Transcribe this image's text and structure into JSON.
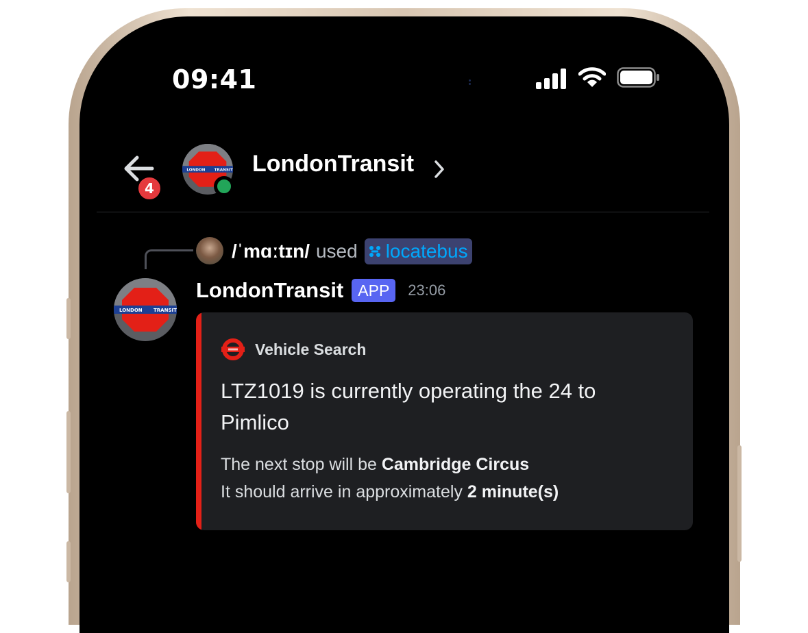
{
  "status_bar": {
    "time": "09:41",
    "icons": [
      "cellular-signal-icon",
      "wifi-icon",
      "battery-icon"
    ]
  },
  "header": {
    "back_icon": "arrow-left-icon",
    "unread_count": "4",
    "title": "LondonTransit",
    "chevron_icon": "chevron-right-icon",
    "online_status_color": "#22a559"
  },
  "reply": {
    "username": "/ˈmɑːtɪn/",
    "used_text": "used",
    "command": "locatebus",
    "command_icon": "slash-command-icon"
  },
  "message": {
    "author": "LondonTransit",
    "badge": "APP",
    "timestamp": "23:06",
    "embed": {
      "accent_color": "#e32017",
      "author_icon": "tfl-roundel-icon",
      "author_name": "Vehicle Search",
      "title": "LTZ1019 is currently operating the 24 to Pimlico",
      "desc_line1_prefix": "The next stop will be ",
      "desc_line1_bold": "Cambridge Circus",
      "desc_line2_prefix": "It should arrive in approximately ",
      "desc_line2_bold": "2 minute(s)"
    }
  },
  "bot_avatar": {
    "logo_text_left": "LONDON",
    "logo_text_right": "TRANSIT",
    "logo_colors": {
      "octagon": "#e32017",
      "bar": "#1c3f94"
    }
  },
  "colors": {
    "background": "#000000",
    "badge_blurple": "#5865f2",
    "command_link": "#00a8fc",
    "unread_badge": "#e5393d"
  }
}
